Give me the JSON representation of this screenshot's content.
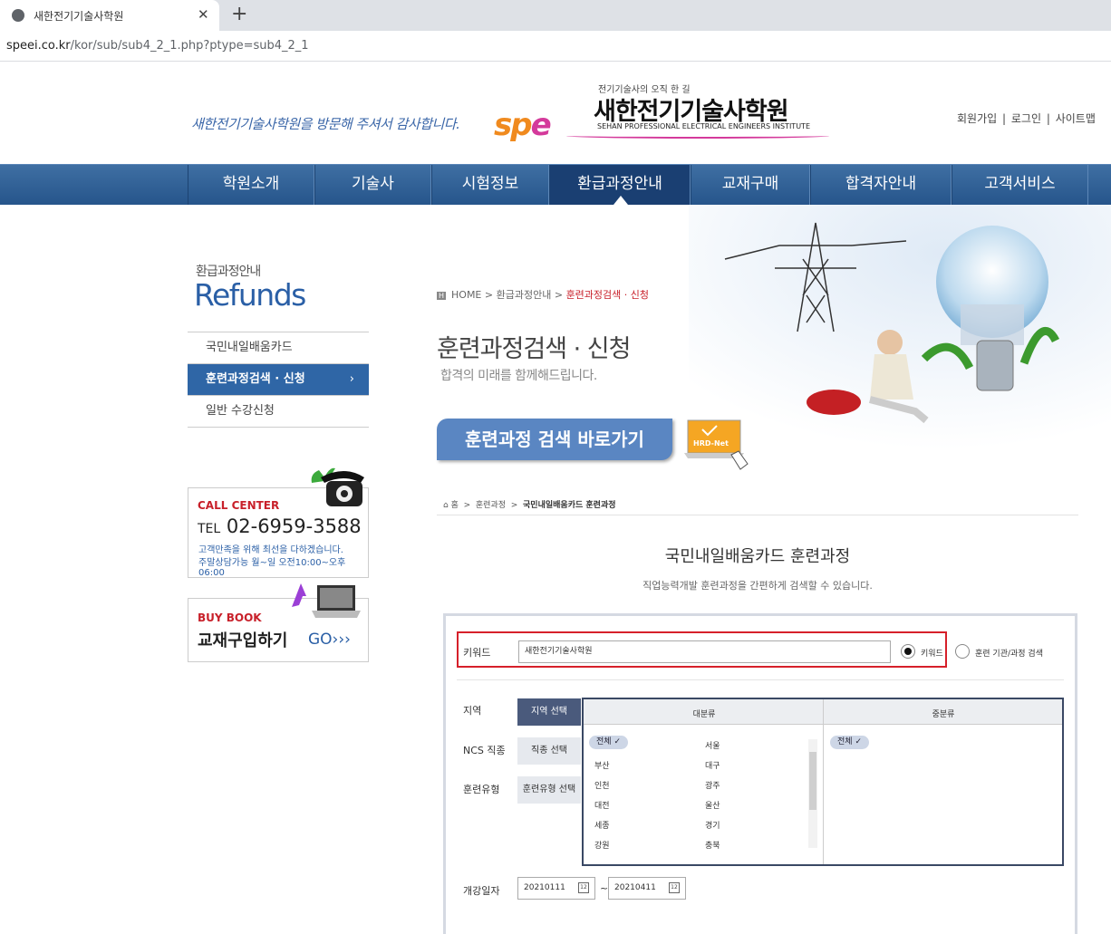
{
  "browser": {
    "tab_title": "새한전기기술사학원",
    "url_domain": "speei.co.kr",
    "url_path": "/kor/sub/sub4_2_1.php?ptype=sub4_2_1"
  },
  "header": {
    "slogan": "새한전기기술사학원을 방문해 주셔서 감사합니다.",
    "logo_mark_1": "sp",
    "logo_mark_2": "e",
    "logo_tagline": "전기기술사의 오직 한 길",
    "logo_name": "새한전기기술사학원",
    "logo_english": "SEHAN PROFESSIONAL ELECTRICAL ENGINEERS INSTITUTE",
    "links": [
      "회원가입",
      "로그인",
      "사이트맵"
    ],
    "link_sep": "|"
  },
  "nav": [
    "학원소개",
    "기술사",
    "시험정보",
    "환급과정안내",
    "교재구매",
    "합격자안내",
    "고객서비스"
  ],
  "sidebar": {
    "title_kr": "환급과정안내",
    "title_en": "Refunds",
    "items": [
      "국민내일배움카드",
      "훈련과정검색 · 신청",
      "일반 수강신청"
    ],
    "active_chevron": "›",
    "call_title": "CALL CENTER",
    "call_tel_prefix": "TEL",
    "call_number": "02-6959-3588",
    "call_note1": "고객만족을 위해 최선을 다하겠습니다.",
    "call_note2": "주말상담가능 월~일 오전10:00~오후06:00",
    "book_title": "BUY BOOK",
    "book_kr": "교재구입하기",
    "book_go": "GO›››"
  },
  "breadcrumb": {
    "home_badge": "H",
    "items": [
      "HOME",
      "환급과정안내",
      "훈련과정검색 · 신청"
    ],
    "sep": ">"
  },
  "page": {
    "title": "훈련과정검색 · 신청",
    "subtitle": "합격의 미래를 함께해드립니다.",
    "go_button": "훈련과정 검색 바로가기",
    "hrd_label": "HRD-Net"
  },
  "embedded": {
    "crumb": [
      "홈",
      "훈련과정",
      "국민내일배움카드 훈련과정"
    ],
    "crumb_home_icon": "⌂",
    "crumb_sep": ">",
    "title": "국민내일배움카드 훈련과정",
    "desc": "직업능력개발 훈련과정을 간편하게 검색할 수 있습니다.",
    "keyword_label": "키워드",
    "keyword_value": "새한전기기술사학원",
    "radio1": "키워드",
    "radio2": "훈련 기관/과정 검색",
    "region_label": "지역",
    "region_btn": "지역 선택",
    "ncs_label": "NCS 직종",
    "ncs_btn": "직종 선택",
    "type_label": "훈련유형",
    "type_btn": "훈련유형 선택",
    "col_major": "대분류",
    "col_minor": "중분류",
    "regions_left": [
      "전체",
      "부산",
      "인천",
      "대전",
      "세종",
      "강원"
    ],
    "regions_right": [
      "서울",
      "대구",
      "광주",
      "울산",
      "경기",
      "충북"
    ],
    "minor_selected": "전체",
    "check_mark": "✓",
    "date_label": "개강일자",
    "date_from": "20210111",
    "date_to": "20210411",
    "date_sep": "~",
    "calendar_text": "12"
  }
}
